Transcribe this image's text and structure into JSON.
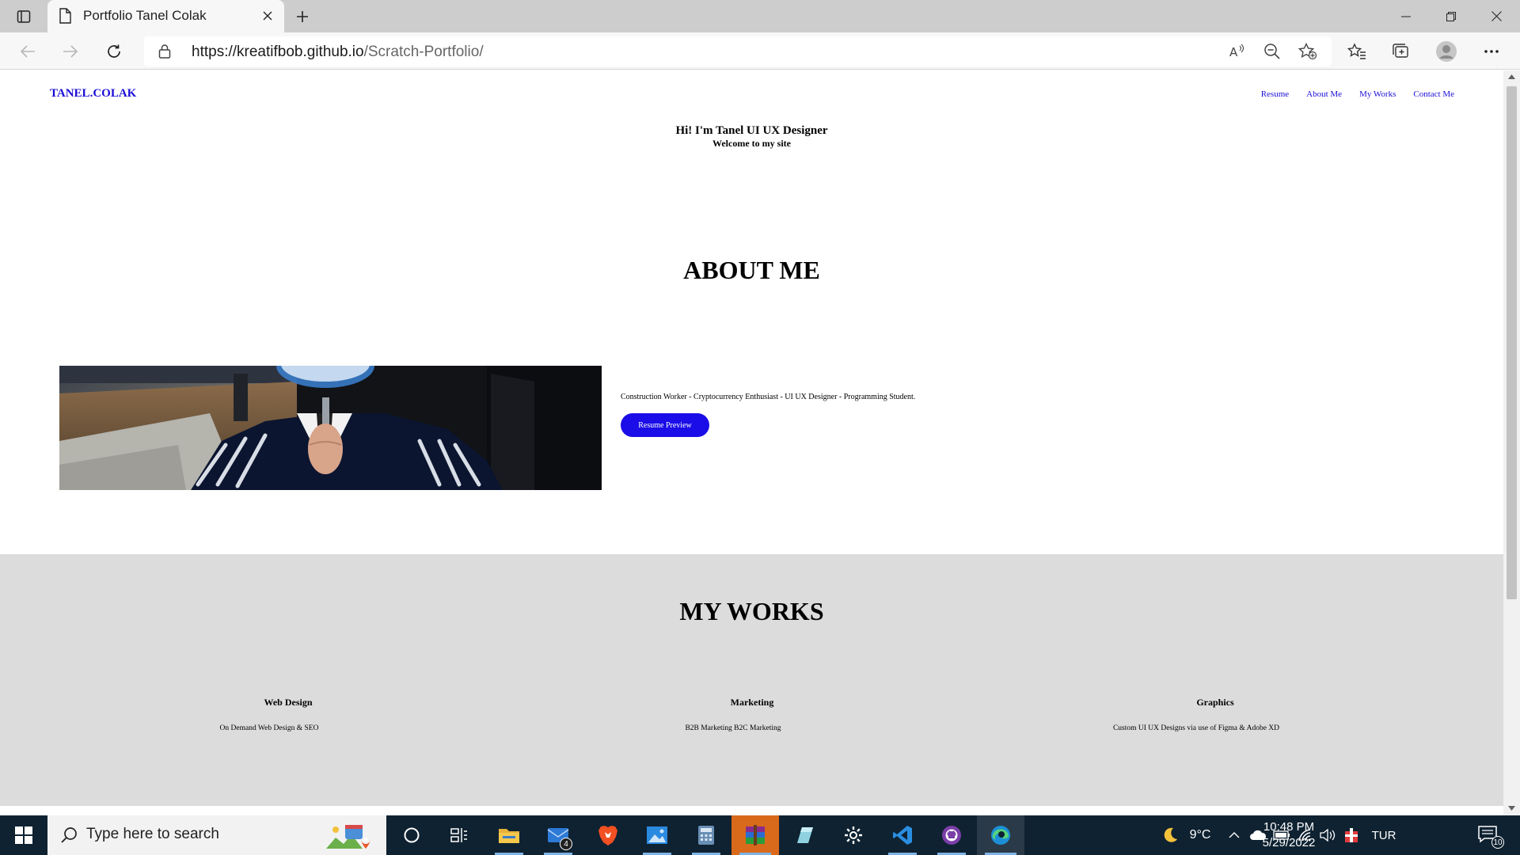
{
  "browser": {
    "tab_title": "Portfolio Tanel Colak",
    "url_host": "https://kreatifbob.github.io",
    "url_path": "/Scratch-Portfolio/"
  },
  "site": {
    "logo": "TANEL.COLAK",
    "nav": [
      "Resume",
      "About Me",
      "My Works",
      "Contact Me"
    ],
    "hero_title": "Hi! I'm Tanel UI UX Designer",
    "hero_subtitle": "Welcome to my site",
    "about_heading": "ABOUT ME",
    "about_text": "Construction Worker - Cryptocurrency Enthusiast - UI UX Designer - Programming Student.",
    "resume_button": "Resume Preview",
    "works_heading": "MY WORKS",
    "works": [
      {
        "title": "Web Design",
        "desc": "On Demand Web Design & SEO"
      },
      {
        "title": "Marketing",
        "desc": "B2B Marketing B2C Marketing"
      },
      {
        "title": "Graphics",
        "desc": "Custom UI UX Designs via use of Figma & Adobe XD"
      }
    ],
    "colors": {
      "link": "#1a0dd6",
      "button": "#1a0de8",
      "works_bg": "#dcdcdc"
    }
  },
  "taskbar": {
    "search_placeholder": "Type here to search",
    "mail_badge": "4",
    "weather_temp": "9°C",
    "language": "TUR",
    "time": "10:48 PM",
    "date": "5/29/2022",
    "notifications": "10",
    "apps": [
      "cortana-icon",
      "task-view-icon",
      "file-explorer-icon",
      "mail-icon",
      "brave-icon",
      "photos-icon",
      "calculator-icon",
      "winrar-icon",
      "notes-icon",
      "settings-icon",
      "vscode-icon",
      "github-desktop-icon",
      "edge-icon"
    ]
  }
}
